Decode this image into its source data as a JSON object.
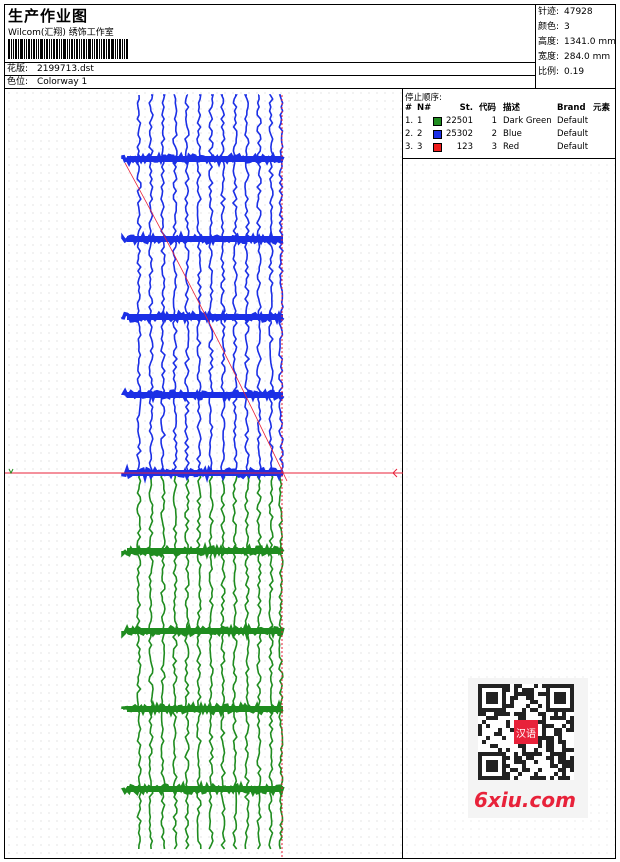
{
  "header": {
    "title": "生产作业图",
    "company": "Wilcom(汇翔) 绣饰工作室",
    "design_label": "花版:",
    "design_value": "2199713.dst",
    "colorway_label": "色位:",
    "colorway_value": "Colorway 1"
  },
  "stats": [
    {
      "label": "针迹:",
      "value": "47928"
    },
    {
      "label": "颜色:",
      "value": "3"
    },
    {
      "label": "高度:",
      "value": "1341.0 mm"
    },
    {
      "label": "宽度:",
      "value": "284.0 mm"
    },
    {
      "label": "比例:",
      "value": "0.19"
    }
  ],
  "stop_sequence": {
    "title": "停止顺序:",
    "headers": {
      "idx": "#",
      "n": "N#",
      "stitches": "St.",
      "code": "代码",
      "desc": "描述",
      "brand": "Brand",
      "element": "元素"
    },
    "rows": [
      {
        "idx": "1.",
        "n": "1",
        "color": "#1f8c1f",
        "stitches": "22501",
        "code": "1",
        "desc": "Dark Green",
        "brand": "Default"
      },
      {
        "idx": "2.",
        "n": "2",
        "color": "#1b2fe6",
        "stitches": "25302",
        "code": "2",
        "desc": "Blue",
        "brand": "Default"
      },
      {
        "idx": "3.",
        "n": "3",
        "color": "#ee1c1c",
        "stitches": "123",
        "code": "3",
        "desc": "Red",
        "brand": "Default"
      }
    ]
  },
  "watermark": {
    "text": "6xiu.com",
    "seal": "汉语"
  },
  "colors": {
    "green": "#1f8c1f",
    "blue": "#1b2fe6",
    "red": "#e8223a"
  }
}
